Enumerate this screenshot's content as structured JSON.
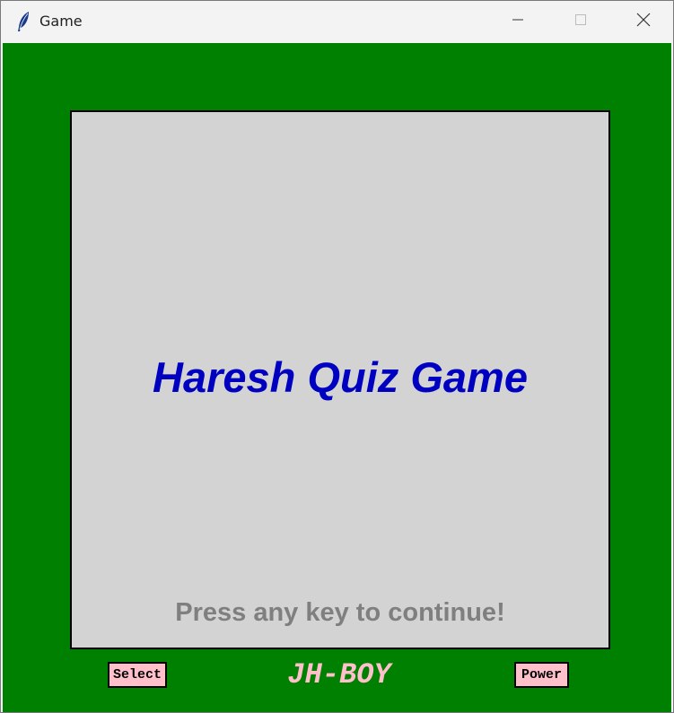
{
  "window": {
    "title": "Game",
    "controls": {
      "minimize_icon": "minimize-icon",
      "maximize_icon": "maximize-icon",
      "close_icon": "close-icon"
    },
    "app_icon": "feather-icon"
  },
  "colors": {
    "background": "#008000",
    "screen": "#d3d3d3",
    "title_text": "#0000c0",
    "prompt_text": "#7f7f7f",
    "button_bg": "#ffc0cb",
    "brand_text": "#ffc0cb"
  },
  "screen": {
    "title": "Haresh Quiz Game",
    "prompt": "Press any key to continue!"
  },
  "controls": {
    "select_label": "Select",
    "power_label": "Power",
    "brand": "JH-BOY"
  }
}
